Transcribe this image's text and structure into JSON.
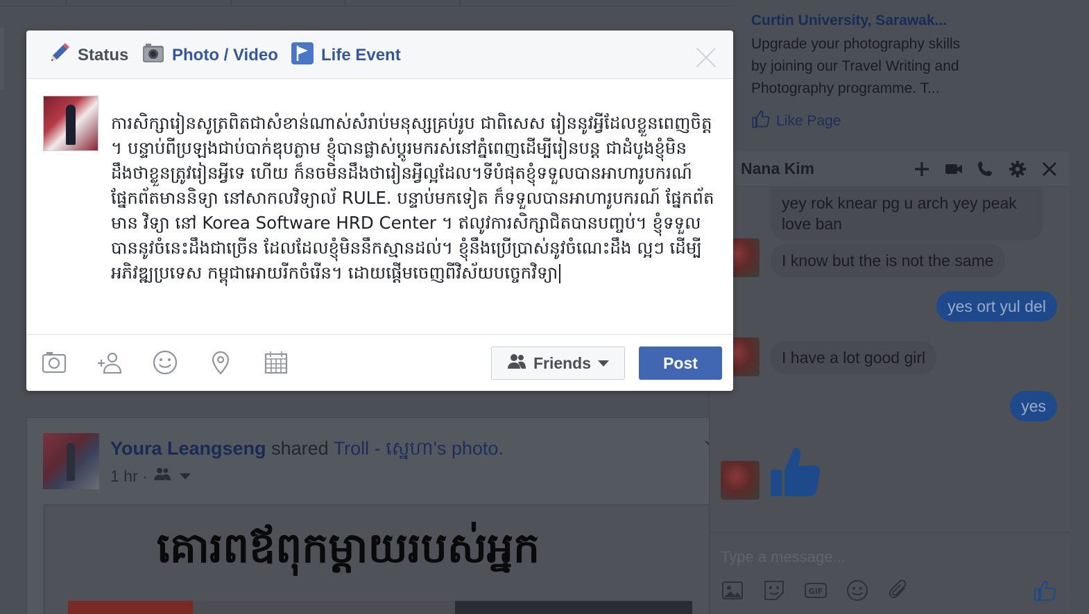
{
  "composer": {
    "tabs": [
      {
        "label": "Status"
      },
      {
        "label": "Photo / Video"
      },
      {
        "label": "Life Event"
      }
    ],
    "text": "ការសិក្សារៀនសូត្រពិតជាសំខាន់ណាស់សំរាប់មនុស្សគ្រប់រូប ជាពិសេស រៀននូវអ្វីដែលខ្លួនពេញចិត្ត ។ បន្ទាប់ពីប្រឡងជាប់បាក់ឌុបភ្លាម ខ្ញុំបានផ្លាស់ប្តូរមករស់នៅភ្នំពេញដើម្បីរៀនបន្ត ជាដំបូងខ្ញុំមិនដឹងថាខ្លួនត្រូវរៀនអ្វីទេ ហើយ ក៏នចមិនដឹងថារៀនអ្វីល្អដែល។ទីបំផុតខ្ញុំទទួលបានអាហារូបករណ៍ ផ្នែកព័តមាននិទ្យា នៅសាកលវិទ្យាល័ RULE. បន្ទាប់មកទៀត ក៏ទទួលបានអាហារូបករណ៍ ផ្នែកព័តមាន វិទ្យា នៅ Korea Software HRD Center ។ ឥលូវការសិក្សាជិតបានបញ្ចប់។ ខ្ញុំទទួល បាននូវចំនេះដឹងជាច្រើន ដែលដែលខ្ញុំមិននឹកស្មានដល់។ ខ្ញុំនឹងប្រើប្រាស់នូវចំណេះដឹង ល្អៗ ដើម្បីអភិវឌ្ឍប្រទេស កម្ពុជាអោយរីកចំរើន។ ដោយផ្តើមចេញពីវិស័យបច្ចេកវិទ្យា",
    "audience": "Friends",
    "post_label": "Post"
  },
  "feed_post": {
    "author": "Youra Leangseng",
    "action": "shared",
    "source": "Troll - ស្នេហា's photo.",
    "time": "1 hr ·",
    "image_caption": "គោរពឪពុកម្តាយរបស់អ្នក"
  },
  "ad": {
    "title": "Curtin University, Sarawak...",
    "body": "Upgrade your photography skills by joining our Travel Writing and Photography programme. T...",
    "like_label": "Like Page"
  },
  "chat": {
    "name": "Nana Kim",
    "messages": [
      {
        "dir": "in",
        "text": "yey rok knear pg u arch yey peak love ban"
      },
      {
        "dir": "in",
        "text": "I know but the is not the same"
      },
      {
        "dir": "out",
        "text": "yes ort yul del"
      },
      {
        "dir": "in",
        "text": "I have a lot good girl"
      },
      {
        "dir": "out",
        "text": "yes"
      }
    ],
    "input_placeholder": "Type a message..."
  },
  "colors": {
    "facebook_blue": "#4267b2",
    "link_blue": "#365899",
    "overlay_gray": "#4b4f56"
  }
}
